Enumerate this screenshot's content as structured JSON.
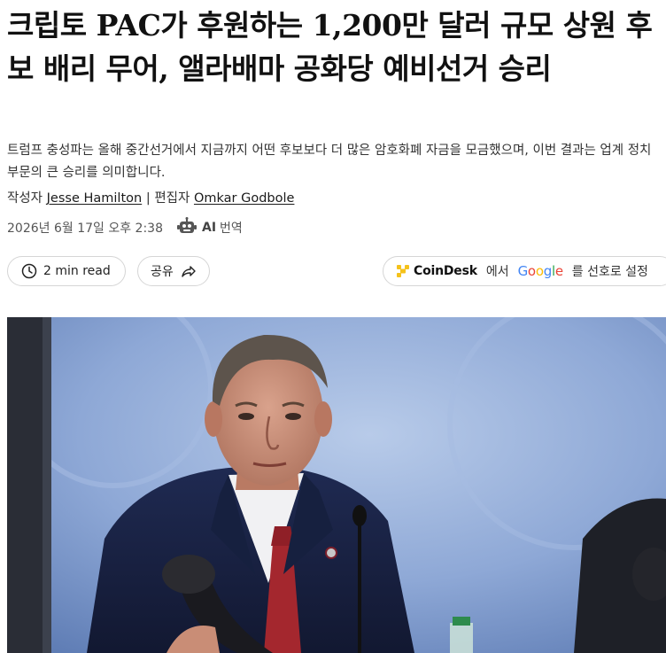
{
  "article": {
    "headline": "크립토 PAC가 후원하는 1,200만 달러 규모 상원 후보 배리 무어, 앨라배마 공화당 예비선거 승리",
    "subtitle": "트럼프 충성파는 올해 중간선거에서 지금까지 어떤 후보보다 더 많은 암호화폐 자금을 모금했으며, 이번 결과는 업계 정치 부문의 큰 승리를 의미합니다.",
    "byline": {
      "author_prefix": "작성자",
      "author": "Jesse Hamilton",
      "separator": "|",
      "editor_prefix": "편집자",
      "editor": "Omkar Godbole"
    },
    "date": "2026년 6월 17일 오후 2:38",
    "ai_label": "AI",
    "translate_label": "번역"
  },
  "actions": {
    "read_time": "2 min read",
    "share_label": "공유",
    "pref_brand": "CoinDesk",
    "pref_middle": "에서",
    "pref_google": "Google",
    "pref_suffix": "를 선호로 설정"
  },
  "colors": {
    "coindesk_yellow": "#f5c21b",
    "google_blue": "#4285F4",
    "google_red": "#EA4335",
    "google_yellow": "#FBBC05",
    "google_green": "#34A853"
  },
  "icons": {
    "clock": "clock-icon",
    "share": "share-arrow-icon",
    "robot": "robot-icon",
    "coindesk": "coindesk-logo-icon"
  }
}
